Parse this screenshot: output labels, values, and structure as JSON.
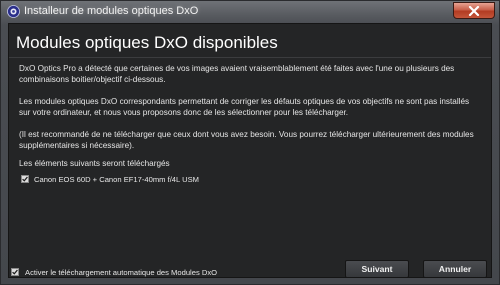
{
  "window": {
    "title": "Installeur de modules optiques DxO",
    "icon": "dxo-app-icon",
    "close_icon": "close-icon"
  },
  "dialog": {
    "heading": "Modules optiques DxO disponibles",
    "paragraphs": [
      "DxO Optics Pro a détecté que certaines de vos images avaient vraisemblablement été faites avec l'une ou plusieurs des combinaisons boitier/objectif ci-dessous.",
      "Les modules optiques DxO correspondants permettant de corriger les défauts optiques de vos objectifs ne sont pas installés sur votre ordinateur, et nous vous proposons donc de les sélectionner pour les télécharger.",
      "(Il est recommandé de ne télécharger que ceux dont vous avez besoin. Vous pourrez télécharger ultérieurement des modules supplémentaires si nécessaire).",
      "Les éléments suivants seront téléchargés"
    ],
    "modules": [
      {
        "label": "Canon EOS 60D + Canon EF17-40mm f/4L USM",
        "checked": true
      }
    ],
    "auto_download": {
      "label": "Activer le téléchargement automatique des Modules DxO",
      "checked": true
    },
    "buttons": {
      "next": "Suivant",
      "cancel": "Annuler"
    }
  }
}
